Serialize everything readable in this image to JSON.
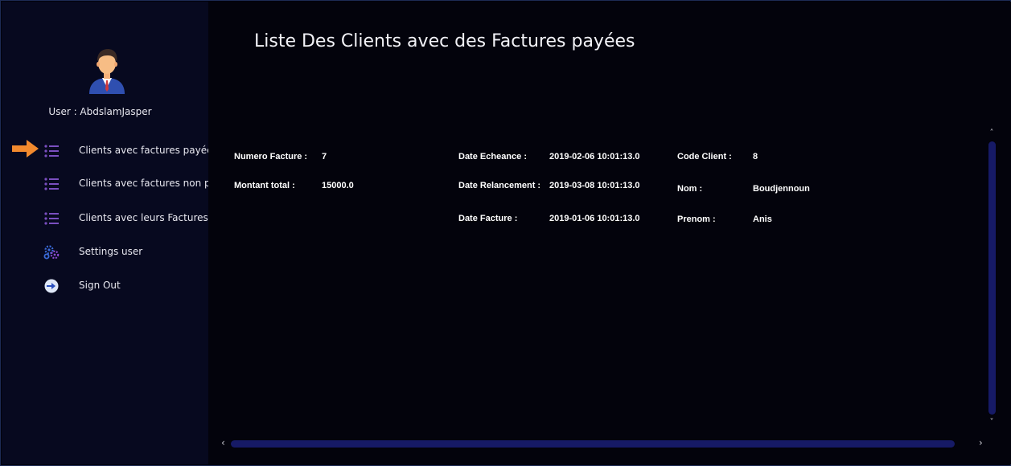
{
  "user": {
    "label": "User : AbdslamJasper"
  },
  "sidebar": {
    "items": [
      {
        "label": "Clients avec factures payées",
        "icon": "list-icon",
        "active": true
      },
      {
        "label": "Clients avec factures non payés",
        "icon": "list-icon",
        "active": false
      },
      {
        "label": "Clients avec leurs Factures",
        "icon": "list-icon",
        "active": false
      },
      {
        "label": "Settings user",
        "icon": "gears-icon",
        "active": false
      },
      {
        "label": "Sign Out",
        "icon": "sign-out-icon",
        "active": false
      }
    ]
  },
  "page": {
    "title": "Liste Des Clients avec des Factures payées"
  },
  "invoice": {
    "numero_label": "Numero Facture :",
    "numero_value": "7",
    "montant_label": "Montant total :",
    "montant_value": "15000.0",
    "echeance_label": "Date Echeance :",
    "echeance_value": "2019-02-06 10:01:13.0",
    "relancement_label": "Date Relancement :",
    "relancement_value": "2019-03-08 10:01:13.0",
    "facture_label": "Date Facture :",
    "facture_value": "2019-01-06 10:01:13.0",
    "code_label": "Code Client :",
    "code_value": "8",
    "nom_label": "Nom :",
    "nom_value": "Boudjennoun",
    "prenom_label": "Prenom :",
    "prenom_value": "Anis"
  },
  "colors": {
    "accent_arrow": "#f28a2e",
    "scrollbar": "#161a66",
    "sidebar_bg": "#07091f",
    "content_bg": "#03030c",
    "list_icon": "#7a4fc0"
  }
}
